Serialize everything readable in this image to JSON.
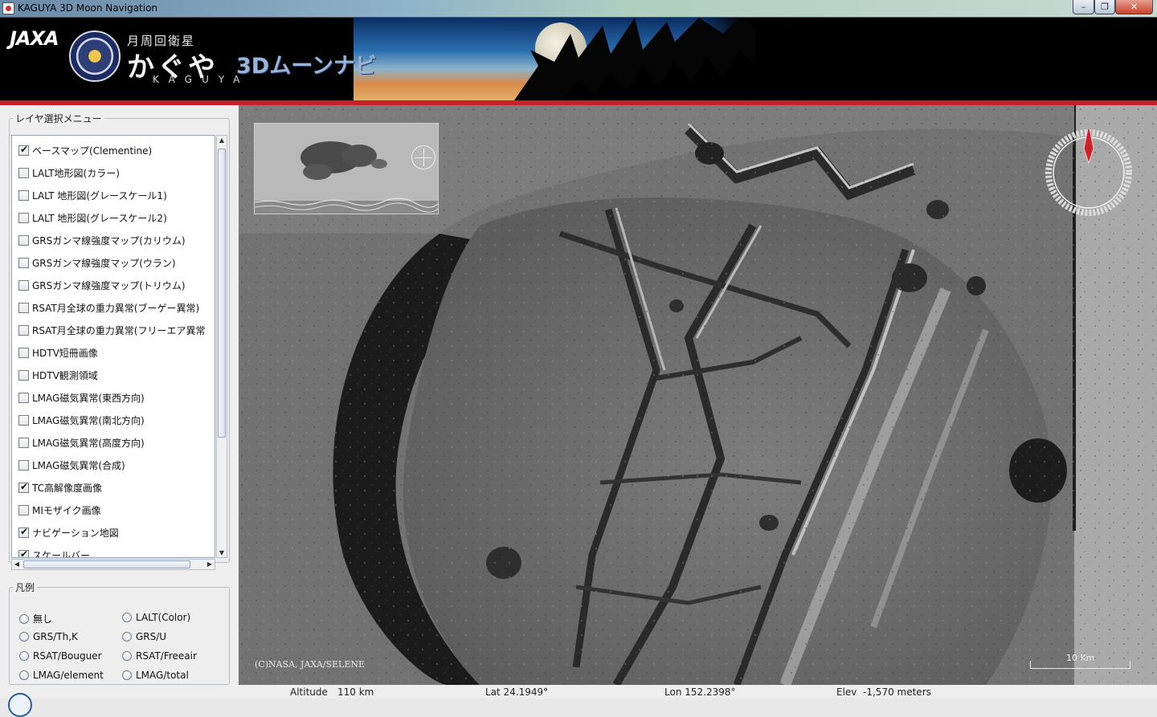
{
  "window": {
    "title": "KAGUYA 3D Moon Navigation",
    "minimize": "–",
    "maximize": "❐",
    "close": "✕"
  },
  "banner": {
    "agency_logo": "JAXA",
    "subtitle": "月周回衛星",
    "name_kana": "かぐや",
    "name_roman": "KAGUYA",
    "app_name": "3Dムーンナビ"
  },
  "layer_menu": {
    "title": "レイヤ選択メニュー",
    "items": [
      {
        "label": "ベースマップ(Clementine)",
        "checked": true
      },
      {
        "label": "LALT地形図(カラー)",
        "checked": false
      },
      {
        "label": "LALT 地形図(グレースケール1)",
        "checked": false
      },
      {
        "label": "LALT 地形図(グレースケール2)",
        "checked": false
      },
      {
        "label": "GRSガンマ線強度マップ(カリウム)",
        "checked": false
      },
      {
        "label": "GRSガンマ線強度マップ(ウラン)",
        "checked": false
      },
      {
        "label": "GRSガンマ線強度マップ(トリウム)",
        "checked": false
      },
      {
        "label": "RSAT月全球の重力異常(ブーゲー異常)",
        "checked": false
      },
      {
        "label": "RSAT月全球の重力異常(フリーエア異常",
        "checked": false
      },
      {
        "label": "HDTV短冊画像",
        "checked": false
      },
      {
        "label": "HDTV観測領域",
        "checked": false
      },
      {
        "label": "LMAG磁気異常(東西方向)",
        "checked": false
      },
      {
        "label": "LMAG磁気異常(南北方向)",
        "checked": false
      },
      {
        "label": "LMAG磁気異常(高度方向)",
        "checked": false
      },
      {
        "label": "LMAG磁気異常(合成)",
        "checked": false
      },
      {
        "label": "TC高解像度画像",
        "checked": true
      },
      {
        "label": "MIモザイク画像",
        "checked": false
      },
      {
        "label": "ナビゲーション地図",
        "checked": true
      },
      {
        "label": "スケールバー",
        "checked": true
      }
    ]
  },
  "legend_panel": {
    "title": "凡例",
    "options": [
      {
        "label": "無し",
        "selected": false
      },
      {
        "label": "LALT(Color)",
        "selected": false
      },
      {
        "label": "GRS/Th,K",
        "selected": false
      },
      {
        "label": "GRS/U",
        "selected": false
      },
      {
        "label": "RSAT/Bouguer",
        "selected": false
      },
      {
        "label": "RSAT/Freeair",
        "selected": false
      },
      {
        "label": "LMAG/element",
        "selected": false
      },
      {
        "label": "LMAG/total",
        "selected": false
      }
    ]
  },
  "map": {
    "copyright": "(C)NASA, JAXA/SELENE",
    "scale_label": "10 Km",
    "compass_color": "#d0202a"
  },
  "status": {
    "altitude_label": "Altitude",
    "altitude_value": "110 km",
    "lat": "Lat 24.1949°",
    "lon": "Lon 152.2398°",
    "elev": "Elev  -1,570 meters"
  },
  "colors": {
    "banner_red_line": "#c8202a",
    "panel_background": "#eeeeee"
  }
}
